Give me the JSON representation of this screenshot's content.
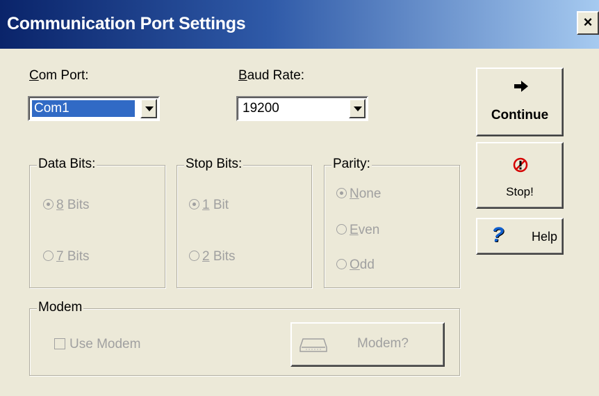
{
  "window": {
    "title": "Communication Port Settings",
    "close_glyph": "×"
  },
  "com_port": {
    "label_hot": "C",
    "label_rest": "om Port:",
    "value": "Com1"
  },
  "baud_rate": {
    "label_hot": "B",
    "label_rest": "aud Rate:",
    "value": "19200"
  },
  "data_bits": {
    "legend": "Data Bits:",
    "options": [
      {
        "hot": "8",
        "rest": " Bits",
        "checked": true
      },
      {
        "hot": "7",
        "rest": " Bits",
        "checked": false
      }
    ]
  },
  "stop_bits": {
    "legend": "Stop Bits:",
    "options": [
      {
        "hot": "1",
        "rest": " Bit",
        "checked": true
      },
      {
        "hot": "2",
        "rest": " Bits",
        "checked": false
      }
    ]
  },
  "parity": {
    "legend": "Parity:",
    "options": [
      {
        "hot": "N",
        "rest": "one",
        "checked": true
      },
      {
        "hot": "E",
        "rest": "ven",
        "checked": false
      },
      {
        "hot": "O",
        "rest": "dd",
        "checked": false
      }
    ]
  },
  "modem": {
    "legend": "Modem",
    "use_modem_label": "Use Modem",
    "use_modem_checked": false,
    "modem_button_label": "Modem?"
  },
  "buttons": {
    "continue_label": "Continue",
    "stop_label": "Stop!",
    "help_label": "Help",
    "help_glyph": "?"
  },
  "icons": {
    "continue": "right-arrow-icon",
    "stop": "stop-no-entry-icon",
    "help": "question-mark-icon",
    "modem": "modem-device-icon"
  },
  "colors": {
    "title_start": "#0a246a",
    "title_end": "#a6caf0",
    "face": "#ece9d8",
    "selection": "#316ac5",
    "stop_red": "#d40000",
    "help_blue": "#1060d0"
  }
}
